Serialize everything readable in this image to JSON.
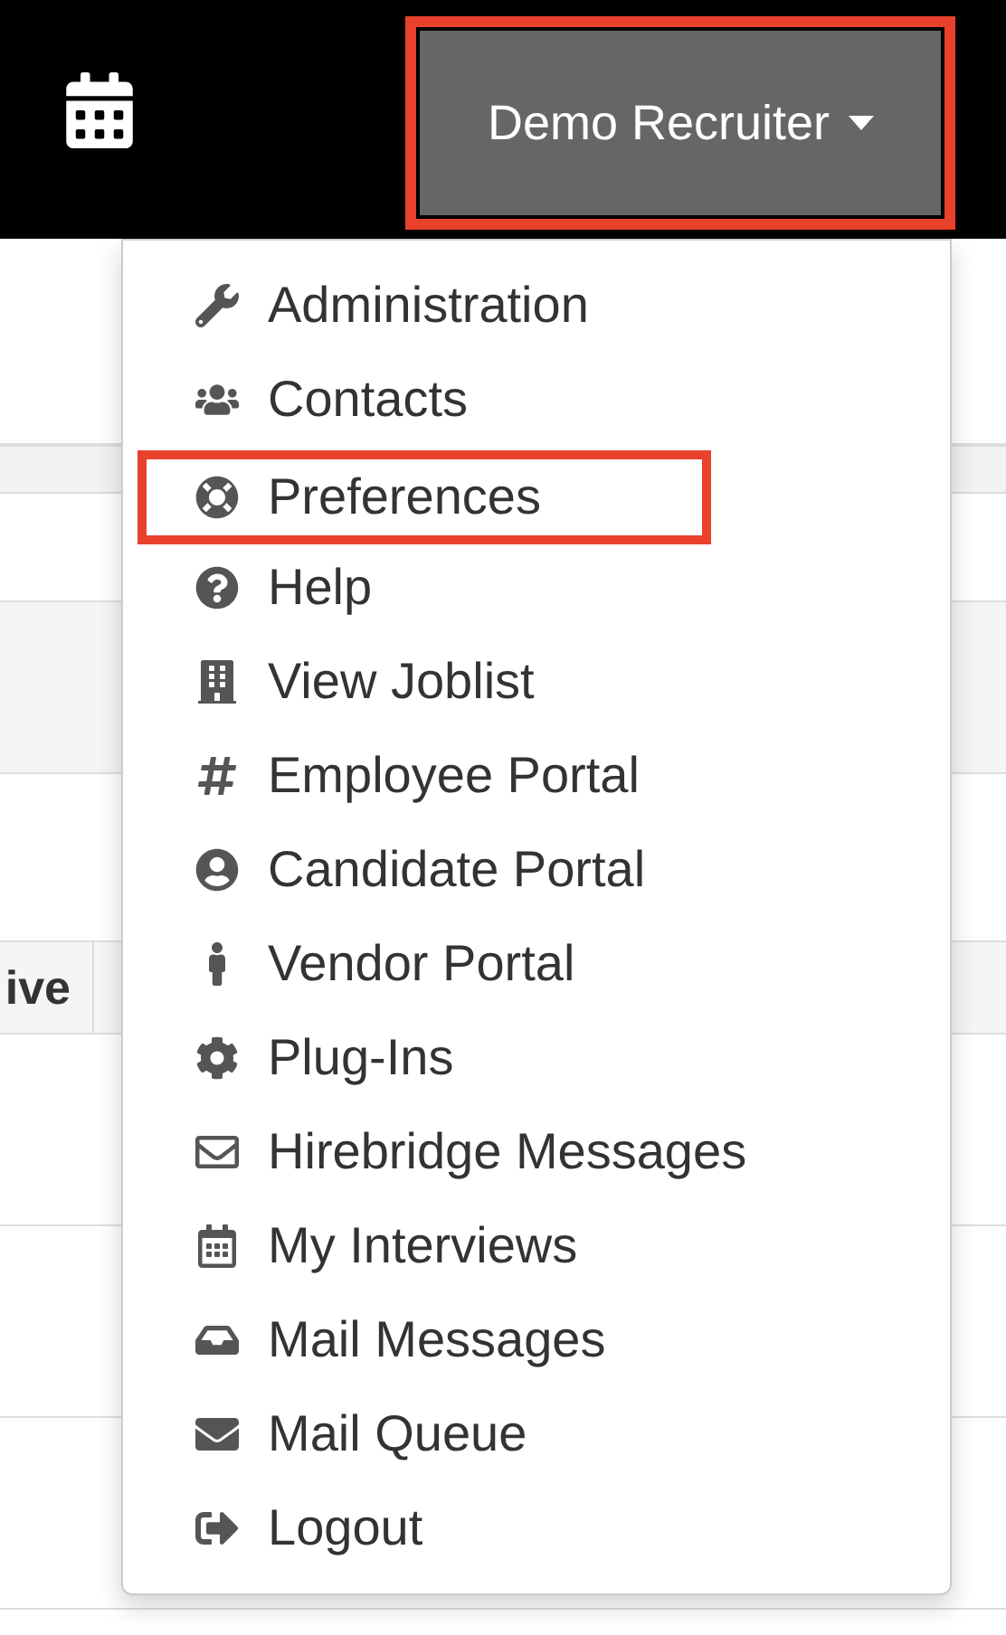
{
  "top_bar": {
    "user_menu": {
      "label": "Demo Recruiter",
      "expanded": true,
      "annotated": true
    }
  },
  "table": {
    "columns": [
      "ive"
    ]
  },
  "menu": {
    "items": [
      {
        "label": "Administration",
        "annotated": false
      },
      {
        "label": "Contacts",
        "annotated": false
      },
      {
        "label": "Preferences",
        "annotated": true
      },
      {
        "label": "Help",
        "annotated": false
      },
      {
        "label": "View Joblist",
        "annotated": false
      },
      {
        "label": "Employee Portal",
        "annotated": false
      },
      {
        "label": "Candidate Portal",
        "annotated": false
      },
      {
        "label": "Vendor Portal",
        "annotated": false
      },
      {
        "label": "Plug-Ins",
        "annotated": false
      },
      {
        "label": "Hirebridge Messages",
        "annotated": false
      },
      {
        "label": "My Interviews",
        "annotated": false
      },
      {
        "label": "Mail Messages",
        "annotated": false
      },
      {
        "label": "Mail Queue",
        "annotated": false
      },
      {
        "label": "Logout",
        "annotated": false
      }
    ]
  }
}
